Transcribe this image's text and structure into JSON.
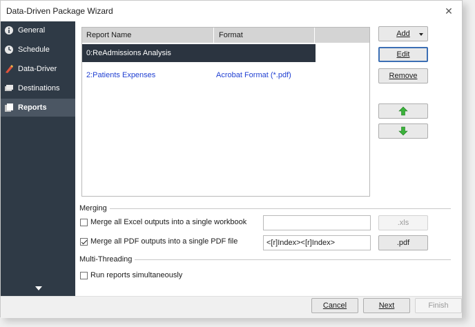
{
  "window": {
    "title": "Data-Driven Package Wizard",
    "close_glyph": "✕"
  },
  "sidebar": {
    "items": [
      {
        "label": "General",
        "icon": "info-icon"
      },
      {
        "label": "Schedule",
        "icon": "clock-icon"
      },
      {
        "label": "Data-Driver",
        "icon": "data-driver-icon"
      },
      {
        "label": "Destinations",
        "icon": "destinations-icon"
      },
      {
        "label": "Reports",
        "icon": "reports-icon",
        "active": true
      }
    ]
  },
  "reports": {
    "columns": [
      "Report Name",
      "Format"
    ],
    "rows": [
      {
        "name": "0:ReAdmissions Analysis",
        "format": ""
      },
      {
        "name": "2:Patients Expenses",
        "format": "Acrobat Format (*.pdf)"
      }
    ]
  },
  "side_buttons": {
    "add": "Add",
    "edit": "Edit",
    "remove": "Remove",
    "move_up": "up-arrow-icon",
    "move_down": "down-arrow-icon"
  },
  "merging": {
    "section": "Merging",
    "excel_label": "Merge all Excel outputs into a single workbook",
    "excel_checked": false,
    "excel_value": "",
    "excel_button": ".xls",
    "pdf_label": "Merge all PDF outputs into a single PDF file",
    "pdf_checked": true,
    "pdf_value": "<[r]Index><[r]Index>",
    "pdf_button": ".pdf"
  },
  "multithreading": {
    "section": "Multi-Threading",
    "simultaneous_label": "Run reports simultaneously",
    "simultaneous_checked": false
  },
  "footer": {
    "cancel": "Cancel",
    "next": "Next",
    "finish": "Finish"
  },
  "colors": {
    "sidebar_bg": "#2f3a46",
    "sidebar_active": "#4b5663",
    "selected_row": "#2b3440",
    "link": "#1f3fd2"
  }
}
